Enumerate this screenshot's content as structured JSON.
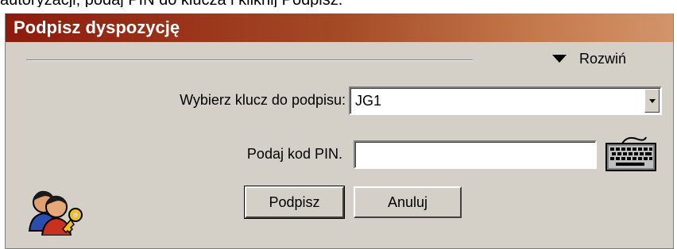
{
  "instruction_text": "autoryzacji, podaj PIN do klucza i kliknij Podpisz.",
  "window": {
    "title": "Podpisz dyspozycję"
  },
  "expand": {
    "label": "Rozwiń",
    "icon": "triangle-down-icon"
  },
  "key_select": {
    "label": "Wybierz klucz do podpisu:",
    "value": "JG1"
  },
  "pin": {
    "label": "Podaj kod PIN.",
    "value": ""
  },
  "buttons": {
    "sign": "Podpisz",
    "cancel": "Anuluj"
  },
  "icons": {
    "keyboard": "keyboard-icon",
    "users": "users-key-icon"
  },
  "colors": {
    "title_start": "#8d1b0d",
    "title_end": "#d2946a",
    "panel": "#d4d0c8"
  }
}
